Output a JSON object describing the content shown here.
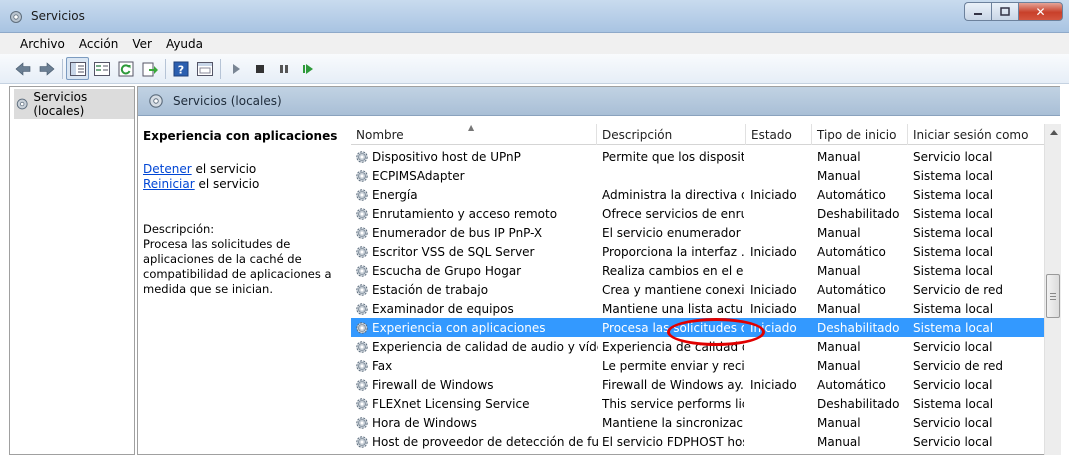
{
  "window": {
    "title": "Servicios"
  },
  "menu": [
    "Archivo",
    "Acción",
    "Ver",
    "Ayuda"
  ],
  "toolbar_icons": [
    "back-icon",
    "forward-icon",
    "console-tree-icon",
    "properties-icon",
    "refresh-icon",
    "export-icon",
    "help-icon",
    "view-icon",
    "start-service-icon",
    "stop-service-icon",
    "pause-service-icon",
    "resume-service-icon"
  ],
  "tree": {
    "root_label": "Servicios (locales)"
  },
  "pane": {
    "header": "Servicios (locales)",
    "details": {
      "title": "Experiencia con aplicaciones",
      "stop_link": "Detener",
      "stop_suffix": " el servicio",
      "restart_link": "Reiniciar",
      "restart_suffix": " el servicio",
      "desc_label": "Descripción:",
      "desc_text": "Procesa las solicitudes de aplicaciones de la caché de compatibilidad de aplicaciones a medida que se inician."
    }
  },
  "table": {
    "columns": [
      "Nombre",
      "Descripción",
      "Estado",
      "Tipo de inicio",
      "Iniciar sesión como"
    ],
    "rows": [
      {
        "name": "Dispositivo host de UPnP",
        "desc": "Permite que los disposit...",
        "estado": "",
        "tipo": "Manual",
        "sesion": "Servicio local"
      },
      {
        "name": "ECPIMSAdapter",
        "desc": "",
        "estado": "",
        "tipo": "Manual",
        "sesion": "Sistema local"
      },
      {
        "name": "Energía",
        "desc": "Administra la directiva d...",
        "estado": "Iniciado",
        "tipo": "Automático",
        "sesion": "Sistema local"
      },
      {
        "name": "Enrutamiento y acceso remoto",
        "desc": "Ofrece servicios de enru...",
        "estado": "",
        "tipo": "Deshabilitado",
        "sesion": "Sistema local"
      },
      {
        "name": "Enumerador de bus IP PnP-X",
        "desc": "El servicio enumerador ...",
        "estado": "",
        "tipo": "Manual",
        "sesion": "Sistema local"
      },
      {
        "name": "Escritor VSS de SQL Server",
        "desc": "Proporciona la interfaz ...",
        "estado": "Iniciado",
        "tipo": "Automático",
        "sesion": "Sistema local"
      },
      {
        "name": "Escucha de Grupo Hogar",
        "desc": "Realiza cambios en el eq...",
        "estado": "",
        "tipo": "Manual",
        "sesion": "Sistema local"
      },
      {
        "name": "Estación de trabajo",
        "desc": "Crea y mantiene conexi...",
        "estado": "Iniciado",
        "tipo": "Automático",
        "sesion": "Servicio de red"
      },
      {
        "name": "Examinador de equipos",
        "desc": "Mantiene una lista actu...",
        "estado": "Iniciado",
        "tipo": "Manual",
        "sesion": "Sistema local"
      },
      {
        "name": "Experiencia con aplicaciones",
        "desc": "Procesa las solicitudes d...",
        "estado": "Iniciado",
        "tipo": "Deshabilitado",
        "sesion": "Sistema local",
        "selected": true
      },
      {
        "name": "Experiencia de calidad de audio y vídeo ...",
        "desc": "Experiencia de calidad d...",
        "estado": "",
        "tipo": "Manual",
        "sesion": "Servicio local"
      },
      {
        "name": "Fax",
        "desc": "Le permite enviar y reci...",
        "estado": "",
        "tipo": "Manual",
        "sesion": "Servicio de red"
      },
      {
        "name": "Firewall de Windows",
        "desc": "Firewall de Windows ay...",
        "estado": "Iniciado",
        "tipo": "Automático",
        "sesion": "Servicio local"
      },
      {
        "name": "FLEXnet Licensing Service",
        "desc": "This service performs lic...",
        "estado": "",
        "tipo": "Deshabilitado",
        "sesion": "Sistema local"
      },
      {
        "name": "Hora de Windows",
        "desc": "Mantiene la sincronizaci...",
        "estado": "",
        "tipo": "Manual",
        "sesion": "Servicio local"
      },
      {
        "name": "Host de proveedor de detección de func...",
        "desc": "El servicio FDPHOST hos...",
        "estado": "",
        "tipo": "Manual",
        "sesion": "Servicio local"
      }
    ]
  },
  "colors": {
    "selection": "#3399ff",
    "highlight_ellipse": "#e00000",
    "link": "#0046d5"
  }
}
